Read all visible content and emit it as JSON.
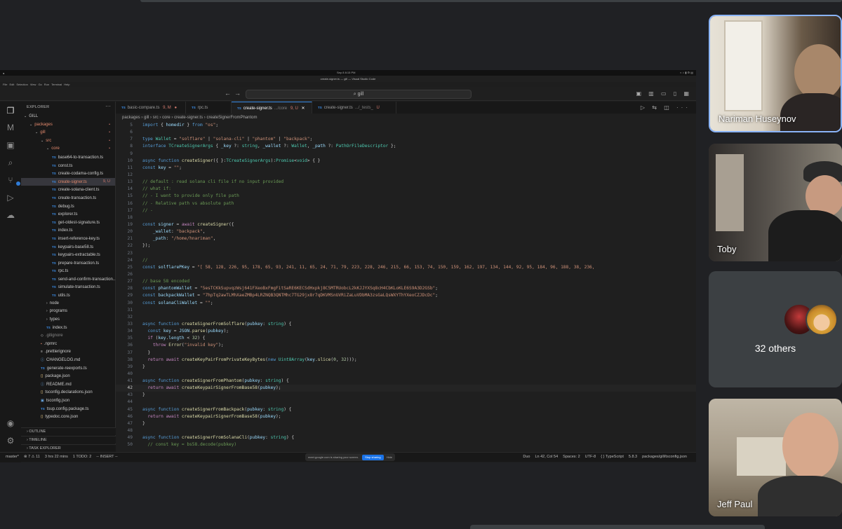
{
  "mac_bar": {
    "date": "Sep 8",
    "time": "8:15 PM"
  },
  "window_title": "create-signer.ts — gill — Visual Studio Code",
  "menu": [
    "File",
    "Edit",
    "Selection",
    "View",
    "Go",
    "Run",
    "Terminal",
    "Help"
  ],
  "command_center": {
    "text": "gill",
    "icon": "search-icon"
  },
  "activity_bar": [
    "explorer-icon",
    "extension-m-icon",
    "package-icon",
    "search-icon",
    "source-control-icon",
    "run-debug-icon",
    "remote-icon",
    "account-icon",
    "settings-icon"
  ],
  "explorer": {
    "title": "EXPLORER",
    "items": [
      {
        "label": "GILL",
        "indent": 0,
        "kind": "folder-open",
        "color": "default"
      },
      {
        "label": "packages",
        "indent": 1,
        "kind": "folder-open",
        "color": "red",
        "status": "•"
      },
      {
        "label": "gill",
        "indent": 2,
        "kind": "folder-open",
        "color": "red",
        "status": "•"
      },
      {
        "label": "src",
        "indent": 3,
        "kind": "folder-open",
        "color": "red",
        "status": "•"
      },
      {
        "label": "core",
        "indent": 4,
        "kind": "folder-open",
        "color": "red",
        "status": "•"
      },
      {
        "label": "base64-to-transaction.ts",
        "indent": 5,
        "kind": "ts",
        "color": "default"
      },
      {
        "label": "const.ts",
        "indent": 5,
        "kind": "ts",
        "color": "default"
      },
      {
        "label": "create-codama-config.ts",
        "indent": 5,
        "kind": "ts",
        "color": "default"
      },
      {
        "label": "create-signer.ts",
        "indent": 5,
        "kind": "ts",
        "color": "red",
        "status": "9, U",
        "selected": true
      },
      {
        "label": "create-solana-client.ts",
        "indent": 5,
        "kind": "ts",
        "color": "default"
      },
      {
        "label": "create-transaction.ts",
        "indent": 5,
        "kind": "ts",
        "color": "default"
      },
      {
        "label": "debug.ts",
        "indent": 5,
        "kind": "ts",
        "color": "default"
      },
      {
        "label": "explorer.ts",
        "indent": 5,
        "kind": "ts",
        "color": "default"
      },
      {
        "label": "get-oldest-signature.ts",
        "indent": 5,
        "kind": "ts",
        "color": "default"
      },
      {
        "label": "index.ts",
        "indent": 5,
        "kind": "ts",
        "color": "default"
      },
      {
        "label": "insert-reference-key.ts",
        "indent": 5,
        "kind": "ts",
        "color": "default"
      },
      {
        "label": "keypairs-base58.ts",
        "indent": 5,
        "kind": "ts",
        "color": "default"
      },
      {
        "label": "keypairs-extractable.ts",
        "indent": 5,
        "kind": "ts",
        "color": "default"
      },
      {
        "label": "prepare-transaction.ts",
        "indent": 5,
        "kind": "ts",
        "color": "default"
      },
      {
        "label": "rpc.ts",
        "indent": 5,
        "kind": "ts",
        "color": "default"
      },
      {
        "label": "send-and-confirm-transaction...",
        "indent": 5,
        "kind": "ts",
        "color": "default"
      },
      {
        "label": "simulate-transaction.ts",
        "indent": 5,
        "kind": "ts",
        "color": "default"
      },
      {
        "label": "utils.ts",
        "indent": 5,
        "kind": "ts",
        "color": "default"
      },
      {
        "label": "node",
        "indent": 4,
        "kind": "folder",
        "color": "default"
      },
      {
        "label": "programs",
        "indent": 4,
        "kind": "folder",
        "color": "default"
      },
      {
        "label": "types",
        "indent": 4,
        "kind": "folder",
        "color": "default"
      },
      {
        "label": "index.ts",
        "indent": 4,
        "kind": "ts",
        "color": "default"
      },
      {
        "label": ".gitignore",
        "indent": 3,
        "kind": "git",
        "color": "grey"
      },
      {
        "label": ".npmrc",
        "indent": 3,
        "kind": "npm",
        "color": "default"
      },
      {
        "label": ".prettierignore",
        "indent": 3,
        "kind": "file",
        "color": "default"
      },
      {
        "label": "CHANGELOG.md",
        "indent": 3,
        "kind": "md",
        "color": "default"
      },
      {
        "label": "generate-reexports.ts",
        "indent": 3,
        "kind": "ts",
        "color": "default"
      },
      {
        "label": "package.json",
        "indent": 3,
        "kind": "json",
        "color": "default"
      },
      {
        "label": "README.md",
        "indent": 3,
        "kind": "md",
        "color": "default"
      },
      {
        "label": "tsconfig.declarations.json",
        "indent": 3,
        "kind": "json",
        "color": "default"
      },
      {
        "label": "tsconfig.json",
        "indent": 3,
        "kind": "tsconfig",
        "color": "default"
      },
      {
        "label": "tsup.config.package.ts",
        "indent": 3,
        "kind": "ts",
        "color": "default"
      },
      {
        "label": "typedoc.core.json",
        "indent": 3,
        "kind": "json",
        "color": "default"
      }
    ],
    "footer": [
      "OUTLINE",
      "TIMELINE",
      "TASK EXPLORER"
    ]
  },
  "tabs": [
    {
      "label": "basic-compare.ts",
      "suffix": "9, M",
      "dot": true,
      "active": false
    },
    {
      "label": "rpc.ts",
      "suffix": "",
      "active": false
    },
    {
      "label": "create-signer.ts",
      "path": ".../core",
      "suffix": "9, U",
      "active": true
    },
    {
      "label": "create-signer.ts",
      "path": ".../_tests_",
      "suffix": "U",
      "active": false
    }
  ],
  "breadcrumb": [
    "packages",
    "gill",
    "src",
    "core",
    "create-signer.ts",
    "createSignerFromPhantom"
  ],
  "code": [
    {
      "n": "5",
      "h": "<span class='k'>import</span> <span class='p'>{ </span><span class='v'>homedir</span><span class='p'> } </span><span class='k'>from</span> <span class='s'>\"os\"</span>;"
    },
    {
      "n": "6",
      "h": ""
    },
    {
      "n": "7",
      "h": "<span class='k'>type</span> <span class='t'>Wallet</span> = <span class='s'>\"solflare\"</span> | <span class='s'>\"solana-cli\"</span> | <span class='s'>\"phantom\"</span> | <span class='s'>\"backpack\"</span>;"
    },
    {
      "n": "8",
      "h": "<span class='k'>interface</span> <span class='t'>TCreateSignerArgs</span> { <span class='v'>_key</span> ?: <span class='t'>string</span>, <span class='v'>_wallet</span> ?: <span class='t'>Wallet</span>, <span class='v'>_path</span> ?: <span class='t'>PathOrFileDescriptor</span> };"
    },
    {
      "n": "9",
      "h": ""
    },
    {
      "n": "10",
      "h": "<span class='k'>async</span> <span class='k'>function</span> <span class='f'>createSigner</span>({ }:<span class='t'>TCreateSignerArgs</span>):<span class='t'>Promise</span>&lt;<span class='t'>void</span>&gt; { }"
    },
    {
      "n": "11",
      "h": "<span class='k'>const</span> <span class='v'>key</span> = <span class='s'>\"\"</span>;"
    },
    {
      "n": "12",
      "h": ""
    },
    {
      "n": "13",
      "h": "<span class='c'>// default : read solana cli file if no input provided</span>"
    },
    {
      "n": "14",
      "h": "<span class='c'>// what if:</span>"
    },
    {
      "n": "15",
      "h": "<span class='c'>// - I want to provide only file path</span>"
    },
    {
      "n": "16",
      "h": "<span class='c'>// - Relative path vs absolute path</span>"
    },
    {
      "n": "17",
      "h": "<span class='c'>// -</span>"
    },
    {
      "n": "18",
      "h": ""
    },
    {
      "n": "19",
      "h": "<span class='k'>const</span> <span class='v'>signer</span> = <span class='kw'>await</span> <span class='f'>createSigner</span>({"
    },
    {
      "n": "20",
      "h": "    <span class='v'>_wallet</span>: <span class='s'>\"backpack\"</span>,"
    },
    {
      "n": "21",
      "h": "    <span class='v'>_path</span>: <span class='s'>\"/home/hnariman\"</span>,"
    },
    {
      "n": "22",
      "h": "});"
    },
    {
      "n": "23",
      "h": ""
    },
    {
      "n": "24",
      "h": "<span class='c'>//</span>"
    },
    {
      "n": "25",
      "h": "<span class='k'>const</span> <span class='v'>solflarePKey</span> = <span class='s'>\"[ 58, 128, 226, 95, 178, 65, 93, 241, 11, 65, 24, 71, 79, 223, 228, 246, 215, 66, 153, 74, 150, 159, 162, 197, 134, 144, 92, 95, 184, 96, 188, 38, 236,</span>"
    },
    {
      "n": "26",
      "h": ""
    },
    {
      "n": "27",
      "h": "<span class='c'>// base 58 encoded</span>"
    },
    {
      "n": "28",
      "h": "<span class='k'>const</span> <span class='v'>phantomWallet</span> = <span class='s'>\"5esTCKkSupvqzWsj641FXeoBxFmgFitSaRE6KECSdHxpkj8C5MTRUobcL2kKJJYXSq8cH4CbKLoKLE6S9A3D2GSb\"</span>;"
    },
    {
      "n": "29",
      "h": "<span class='k'>const</span> <span class='v'>backpackWallet</span> = <span class='s'>\"7hpTq2awTLMhXaeZMBp4LRZNQB3QNTMhc7TG29jx8r7qDKVMSnUVRiZaLuVDbMA3zsGaLQsWXYThYXeoCZJDcDc\"</span>;"
    },
    {
      "n": "30",
      "h": "<span class='k'>const</span> <span class='v'>solanaCliWallet</span> = <span class='s'>\"\"</span>;"
    },
    {
      "n": "31",
      "h": ""
    },
    {
      "n": "32",
      "h": ""
    },
    {
      "n": "33",
      "h": "<span class='k'>async</span> <span class='k'>function</span> <span class='f'>createSignerFromSolflare</span>(<span class='v'>pubkey</span>: <span class='t'>string</span>) {"
    },
    {
      "n": "34",
      "h": "  <span class='k'>const</span> <span class='v'>key</span> = <span class='v'>JSON</span>.<span class='f'>parse</span>(<span class='v'>pubkey</span>);"
    },
    {
      "n": "35",
      "h": "  <span class='kw'>if</span> (<span class='v'>key</span>.<span class='v'>length</span> &lt; <span class='n'>32</span>) {"
    },
    {
      "n": "36",
      "h": "    <span class='kw'>throw</span> <span class='f'>Error</span>(<span class='s'>\"invalid key\"</span>);"
    },
    {
      "n": "37",
      "h": "  }"
    },
    {
      "n": "38",
      "h": "  <span class='kw'>return</span> <span class='kw'>await</span> <span class='f'>createKeyPairFromPrivateKeyBytes</span>(<span class='k'>new</span> <span class='t'>Uint8Array</span>(<span class='v'>key</span>.<span class='f'>slice</span>(<span class='n'>0</span>, <span class='n'>32</span>)));"
    },
    {
      "n": "39",
      "h": "}"
    },
    {
      "n": "40",
      "h": ""
    },
    {
      "n": "41",
      "h": "<span class='k'>async</span> <span class='k'>function</span> <span class='f'>createSignerFromPhantom</span>(<span class='v'>pubkey</span>: <span class='t'>string</span>) {"
    },
    {
      "n": "42",
      "h": "  <span class='kw'>return</span> <span class='kw'>await</span> <span class='f'>createKeypairSignerFromBase58</span>(<span class='v'>pubkey</span>);",
      "current": true
    },
    {
      "n": "43",
      "h": "}"
    },
    {
      "n": "44",
      "h": ""
    },
    {
      "n": "45",
      "h": "<span class='k'>async</span> <span class='k'>function</span> <span class='f'>createSignerFromBackpack</span>(<span class='v'>pubkey</span>: <span class='t'>string</span>) {"
    },
    {
      "n": "46",
      "h": "  <span class='kw'>return</span> <span class='kw'>await</span> <span class='f'>createKeypairSignerFromBase58</span>(<span class='v'>pubkey</span>);"
    },
    {
      "n": "47",
      "h": "}"
    },
    {
      "n": "48",
      "h": ""
    },
    {
      "n": "49",
      "h": "<span class='k'>async</span> <span class='k'>function</span> <span class='f'>createSignerFromSolanaCli</span>(<span class='v'>pubkey</span>: <span class='t'>string</span>) {"
    },
    {
      "n": "50",
      "h": "  <span class='c'>// const key = bs58.decode(pubkey)</span>"
    }
  ],
  "statusbar": {
    "left": [
      "master*",
      "⊗ 7 ⚠ 11",
      "3 hrs 22 mins",
      "1  TODO: 2",
      "-- INSERT --"
    ],
    "share_text": "meet.google.com is sharing your screen.",
    "share_stop": "Stop sharing",
    "share_hide": "Hide",
    "right": [
      "Duo",
      "Ln 42, Col 54",
      "Spaces: 2",
      "UTF-8",
      "{ } TypeScript",
      "5.8.3",
      "packages/gill/tsconfig.json"
    ]
  },
  "participants": {
    "nariman": "Nariman Huseynov",
    "toby": "Toby",
    "others": "32 others",
    "jeff": "Jeff Paul"
  },
  "colors": {
    "accent": "#8ab4f8",
    "ts_blue": "#3b8eea",
    "modified": "#d0796d"
  }
}
